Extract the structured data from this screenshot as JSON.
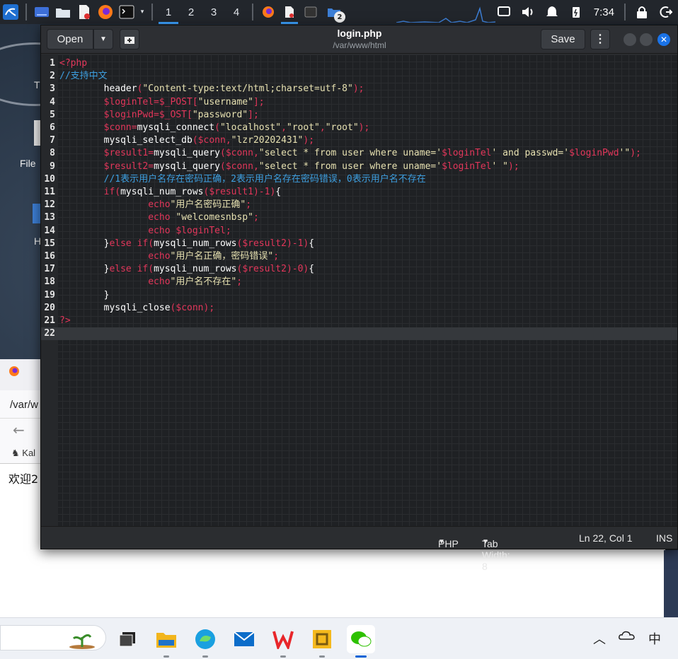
{
  "panel": {
    "workspaces": [
      "1",
      "2",
      "3",
      "4"
    ],
    "active_workspace": "1",
    "badge_count": "2",
    "time": "7:34"
  },
  "desktop": {
    "labels": [
      "T",
      "File",
      "H"
    ]
  },
  "browser": {
    "url_partial": "/var/w",
    "bookmark_partial": "Kal",
    "content_partial": "欢迎2"
  },
  "editor": {
    "open_label": "Open",
    "save_label": "Save",
    "title": "login.php",
    "subtitle": "/var/www/html",
    "lines": [
      {
        "n": "1",
        "segs": [
          [
            "kw",
            "<?php"
          ]
        ]
      },
      {
        "n": "2",
        "segs": [
          [
            "cm",
            "//支持中文"
          ]
        ]
      },
      {
        "n": "3",
        "segs": [
          [
            "fn",
            "        header"
          ],
          [
            "pun",
            "("
          ],
          [
            "str",
            "\"Content-type:text/html;charset=utf-8\""
          ],
          [
            "pun",
            ");"
          ]
        ]
      },
      {
        "n": "4",
        "segs": [
          [
            "var",
            "        $loginTel=$_POST["
          ],
          [
            "str",
            "\"username\""
          ],
          [
            "pun",
            "];"
          ]
        ]
      },
      {
        "n": "5",
        "segs": [
          [
            "var",
            "        $loginPwd=$_OST["
          ],
          [
            "str",
            "\"password\""
          ],
          [
            "pun",
            "];"
          ]
        ]
      },
      {
        "n": "6",
        "segs": [
          [
            "var",
            "        $conn="
          ],
          [
            "fn",
            "mysqli_connect"
          ],
          [
            "pun",
            "("
          ],
          [
            "str",
            "\"localhost\""
          ],
          [
            "pun",
            ","
          ],
          [
            "str",
            "\"root\""
          ],
          [
            "pun",
            ","
          ],
          [
            "str",
            "\"root\""
          ],
          [
            "pun",
            ");"
          ]
        ]
      },
      {
        "n": "7",
        "segs": [
          [
            "fn",
            "        mysqli_select_db"
          ],
          [
            "pun",
            "("
          ],
          [
            "var",
            "$conn"
          ],
          [
            "pun",
            ","
          ],
          [
            "str",
            "\"lzr20202431\""
          ],
          [
            "pun",
            ");"
          ]
        ]
      },
      {
        "n": "8",
        "segs": [
          [
            "var",
            "        $result1="
          ],
          [
            "fn",
            "mysqli_query"
          ],
          [
            "pun",
            "("
          ],
          [
            "var",
            "$conn"
          ],
          [
            "pun",
            ","
          ],
          [
            "str",
            "\"select * from user where uname='"
          ],
          [
            "var",
            "$loginTel"
          ],
          [
            "str",
            "' and passwd='"
          ],
          [
            "var",
            "$loginPwd"
          ],
          [
            "str",
            "'\""
          ],
          [
            "pun",
            ");"
          ]
        ]
      },
      {
        "n": "9",
        "segs": [
          [
            "var",
            "        $result2="
          ],
          [
            "fn",
            "mysqli_query"
          ],
          [
            "pun",
            "("
          ],
          [
            "var",
            "$conn"
          ],
          [
            "pun",
            ","
          ],
          [
            "str",
            "\"select * from user where uname='"
          ],
          [
            "var",
            "$loginTel"
          ],
          [
            "str",
            "' \""
          ],
          [
            "pun",
            ");"
          ]
        ]
      },
      {
        "n": "10",
        "segs": [
          [
            "cm",
            "        //1表示用户名存在密码正确，2表示用户名存在密码错误，0表示用户名不存在"
          ]
        ]
      },
      {
        "n": "11",
        "segs": [
          [
            "kw",
            "        if"
          ],
          [
            "pun",
            "("
          ],
          [
            "fn",
            "mysqli_num_rows"
          ],
          [
            "pun",
            "("
          ],
          [
            "var",
            "$result1"
          ],
          [
            "pun",
            ")-1)"
          ],
          [
            "fn",
            "{"
          ]
        ]
      },
      {
        "n": "12",
        "segs": [
          [
            "kw",
            "                echo"
          ],
          [
            "str",
            "\"用户名密码正确\""
          ],
          [
            "pun",
            ";"
          ]
        ]
      },
      {
        "n": "13",
        "segs": [
          [
            "kw",
            "                echo "
          ],
          [
            "str",
            "\"welcomesnbsp\""
          ],
          [
            "pun",
            ";"
          ]
        ]
      },
      {
        "n": "14",
        "segs": [
          [
            "kw",
            "                echo "
          ],
          [
            "var",
            "$loginTel"
          ],
          [
            "pun",
            ";"
          ]
        ]
      },
      {
        "n": "15",
        "segs": [
          [
            "fn",
            "        }"
          ],
          [
            "kw",
            "else if"
          ],
          [
            "pun",
            "("
          ],
          [
            "fn",
            "mysqli_num_rows"
          ],
          [
            "pun",
            "("
          ],
          [
            "var",
            "$result2"
          ],
          [
            "pun",
            ")-1)"
          ],
          [
            "fn",
            "{"
          ]
        ]
      },
      {
        "n": "16",
        "segs": [
          [
            "kw",
            "                echo"
          ],
          [
            "str",
            "\"用户名正确，密码错误\""
          ],
          [
            "pun",
            ";"
          ]
        ]
      },
      {
        "n": "17",
        "segs": [
          [
            "fn",
            "        }"
          ],
          [
            "kw",
            "else if"
          ],
          [
            "pun",
            "("
          ],
          [
            "fn",
            "mysqli_num_rows"
          ],
          [
            "pun",
            "("
          ],
          [
            "var",
            "$result2"
          ],
          [
            "pun",
            ")-0)"
          ],
          [
            "fn",
            "{"
          ]
        ]
      },
      {
        "n": "18",
        "segs": [
          [
            "kw",
            "                echo"
          ],
          [
            "str",
            "\"用户名不存在\""
          ],
          [
            "pun",
            ";"
          ]
        ]
      },
      {
        "n": "19",
        "segs": [
          [
            "fn",
            "        }"
          ]
        ]
      },
      {
        "n": "20",
        "segs": [
          [
            "fn",
            "        mysqli_close"
          ],
          [
            "pun",
            "("
          ],
          [
            "var",
            "$conn"
          ],
          [
            "pun",
            ");"
          ]
        ]
      },
      {
        "n": "21",
        "segs": [
          [
            "kw",
            "?>"
          ]
        ]
      },
      {
        "n": "22",
        "segs": []
      }
    ],
    "current_line": "22",
    "status": {
      "language": "PHP",
      "tab_width": "Tab Width: 8",
      "position": "Ln 22, Col 1",
      "mode": "INS"
    }
  },
  "taskbar": {
    "ime": "中"
  },
  "colors": {
    "keyword": "#e2365a",
    "string": "#e6e0b0",
    "comment": "#3d9fe0",
    "accent": "#3da2ff"
  }
}
